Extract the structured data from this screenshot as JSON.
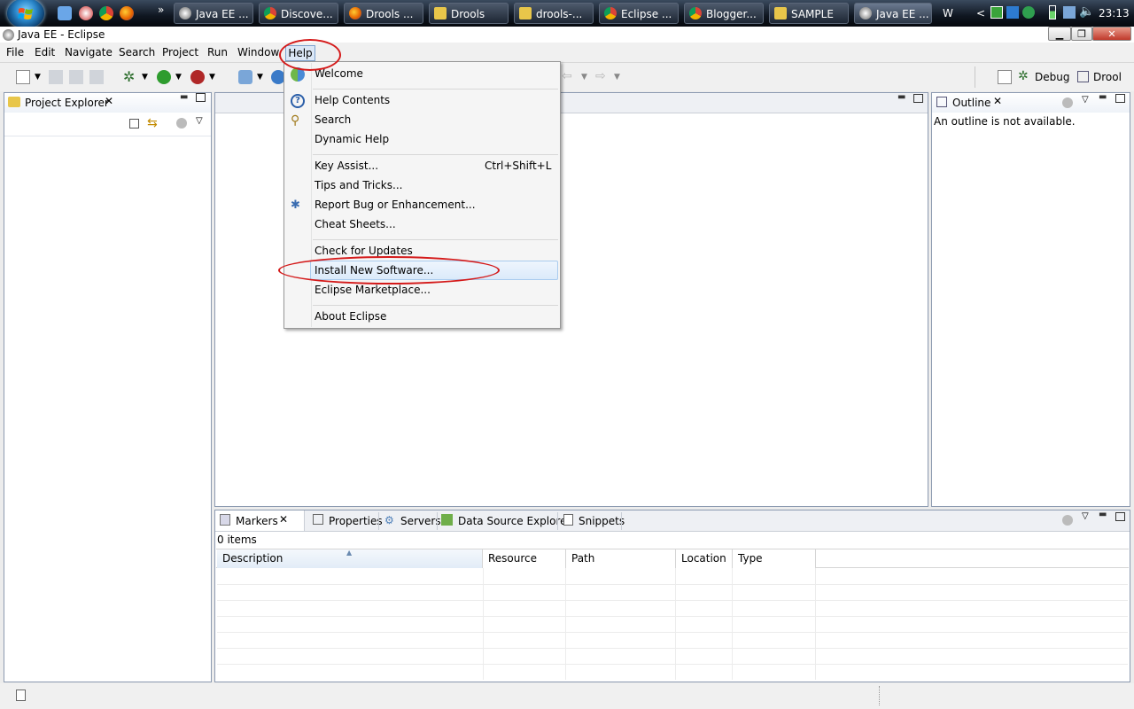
{
  "taskbar": {
    "buttons": [
      {
        "label": "Java EE ...",
        "icon": "eclipse-icon"
      },
      {
        "label": "Discove...",
        "icon": "chrome-icon"
      },
      {
        "label": "Drools ...",
        "icon": "firefox-icon"
      },
      {
        "label": "Drools",
        "icon": "folder-icon"
      },
      {
        "label": "drools-...",
        "icon": "folder-icon"
      },
      {
        "label": "Eclipse ...",
        "icon": "chrome-icon"
      },
      {
        "label": "Blogger...",
        "icon": "chrome-icon"
      },
      {
        "label": "SAMPLE",
        "icon": "folder-icon"
      },
      {
        "label": "Java EE ...",
        "icon": "eclipse-icon"
      }
    ],
    "chevron": "»",
    "tray_letter": "W",
    "tray_chevron": "<",
    "clock": "23:13"
  },
  "window": {
    "title": "Java EE - Eclipse"
  },
  "menubar": {
    "items": [
      "File",
      "Edit",
      "Navigate",
      "Search",
      "Project",
      "Run",
      "Window",
      "Help"
    ]
  },
  "perspectives": {
    "debug": "Debug",
    "drools": "Drool"
  },
  "project_explorer": {
    "title": "Project Explorer"
  },
  "outline": {
    "title": "Outline",
    "message": "An outline is not available."
  },
  "help_menu": {
    "items": [
      {
        "label": "Welcome",
        "shortcut": ""
      },
      {
        "label": "Help Contents",
        "shortcut": ""
      },
      {
        "label": "Search",
        "shortcut": ""
      },
      {
        "label": "Dynamic Help",
        "shortcut": ""
      },
      {
        "label": "Key Assist...",
        "shortcut": "Ctrl+Shift+L"
      },
      {
        "label": "Tips and Tricks...",
        "shortcut": ""
      },
      {
        "label": "Report Bug or Enhancement...",
        "shortcut": ""
      },
      {
        "label": "Cheat Sheets...",
        "shortcut": ""
      },
      {
        "label": "Check for Updates",
        "shortcut": ""
      },
      {
        "label": "Install New Software...",
        "shortcut": ""
      },
      {
        "label": "Eclipse Marketplace...",
        "shortcut": ""
      },
      {
        "label": "About Eclipse",
        "shortcut": ""
      }
    ],
    "highlighted": "Install New Software..."
  },
  "bottom_panel": {
    "tabs": [
      "Markers",
      "Properties",
      "Servers",
      "Data Source Explorer",
      "Snippets"
    ],
    "items_count": "0 items",
    "columns": [
      "Description",
      "Resource",
      "Path",
      "Location",
      "Type"
    ]
  },
  "colors": {
    "annotation_red": "#d41a1a",
    "menu_highlight": "#dbeafa",
    "panel_border": "#8c9ab0"
  }
}
